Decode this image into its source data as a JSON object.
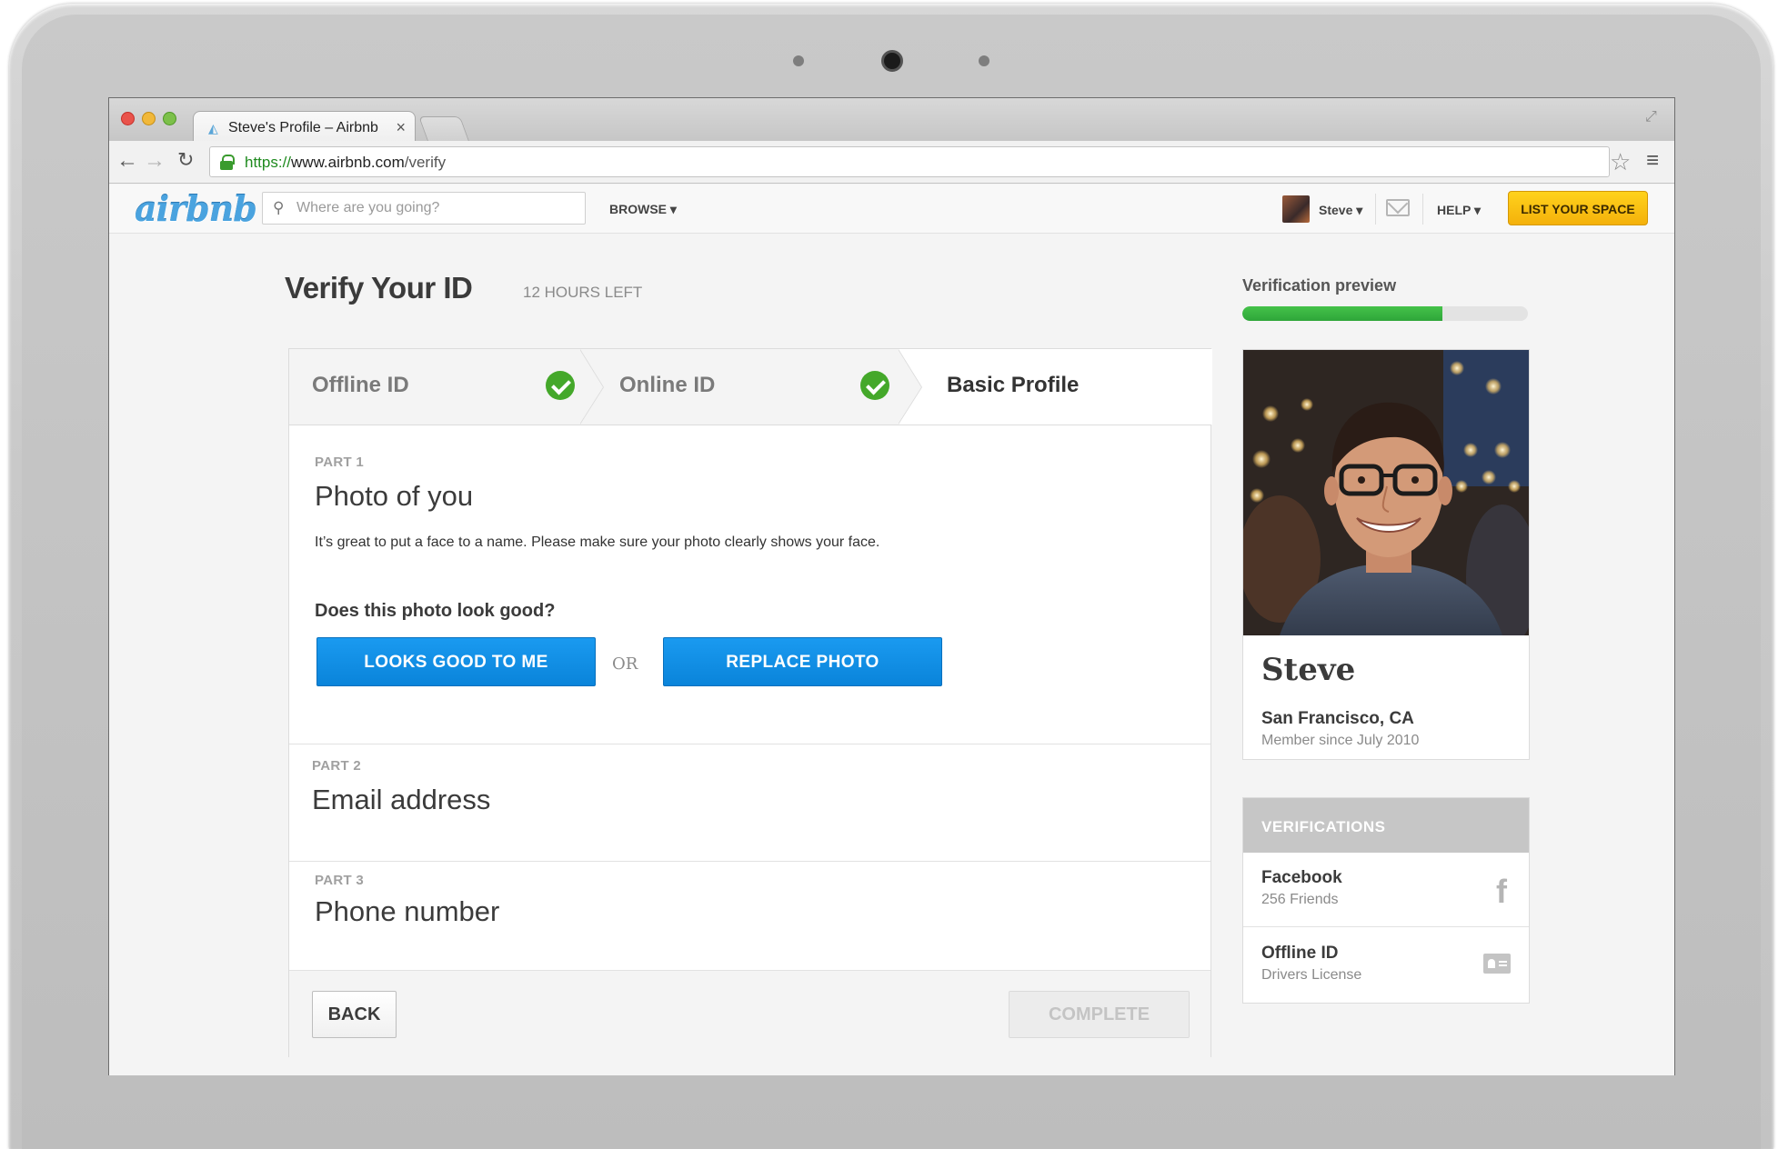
{
  "browser": {
    "tab_title": "Steve's Profile – Airbnb",
    "url_scheme": "https://",
    "url_host": "www.airbnb.com",
    "url_path": "/verify"
  },
  "header": {
    "logo": "airbnb",
    "search_placeholder": "Where are you going?",
    "browse_label": "BROWSE ▾",
    "user_label": "Steve ▾",
    "help_label": "HELP ▾",
    "list_space_label": "LIST YOUR SPACE"
  },
  "page": {
    "title": "Verify Your ID",
    "hours_left": "12 HOURS LEFT"
  },
  "steps": [
    {
      "label": "Offline ID",
      "completed": true
    },
    {
      "label": "Online ID",
      "completed": true
    },
    {
      "label": "Basic Profile",
      "completed": false
    }
  ],
  "parts": {
    "part1": {
      "label": "PART 1",
      "title": "Photo of you",
      "description": "It’s great to put a face to a name. Please make sure your photo clearly shows your face.",
      "question": "Does this photo look good?",
      "good_button": "LOOKS GOOD TO ME",
      "or_text": "OR",
      "replace_button": "REPLACE PHOTO"
    },
    "part2": {
      "label": "PART 2",
      "title": "Email address"
    },
    "part3": {
      "label": "PART 3",
      "title": "Phone number"
    }
  },
  "footer": {
    "back_label": "BACK",
    "complete_label": "COMPLETE"
  },
  "sidebar": {
    "preview_label": "Verification preview",
    "progress_fraction": 0.7,
    "profile": {
      "name": "Steve",
      "city": "San Francisco, CA",
      "member_since": "Member since July 2010"
    },
    "verifications_header": "VERIFICATIONS",
    "verifications": [
      {
        "title": "Facebook",
        "subtitle": "256 Friends",
        "icon": "facebook-icon"
      },
      {
        "title": "Offline ID",
        "subtitle": "Drivers License",
        "icon": "id-card-icon"
      }
    ]
  },
  "colors": {
    "accent_blue": "#0a84da",
    "success_green": "#44a82a",
    "list_space_yellow": "#ffd21c",
    "logo_blue": "#4aa3df"
  }
}
